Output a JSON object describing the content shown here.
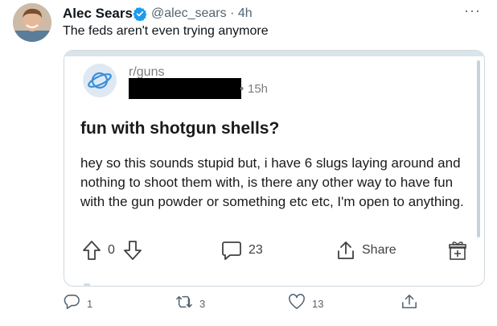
{
  "tweet": {
    "author_name": "Alec Sears",
    "handle_time": "@alec_sears · 4h",
    "text": "The feds aren't even trying anymore",
    "more_label": "···",
    "replies": "1",
    "retweets": "3",
    "likes": "13"
  },
  "embed": {
    "subreddit": "r/guns",
    "time": "15h",
    "title": "fun with shotgun shells?",
    "body": "hey so this sounds stupid but, i have 6 slugs laying around and nothing to shoot them with, is there any other way to have fun with the gun powder or something etc etc, I'm open to anything.",
    "votes": "0",
    "comments": "23",
    "share_label": "Share"
  },
  "colors": {
    "verified": "#1d9bf0",
    "secondary_text": "#536471",
    "border": "#cfd9de"
  },
  "icons": [
    "verified-badge-icon",
    "more-icon",
    "reddit-icon",
    "upvote-icon",
    "downvote-icon",
    "comment-icon",
    "share-icon",
    "award-icon",
    "reply-icon",
    "retweet-icon",
    "like-icon",
    "tweet-share-icon"
  ]
}
